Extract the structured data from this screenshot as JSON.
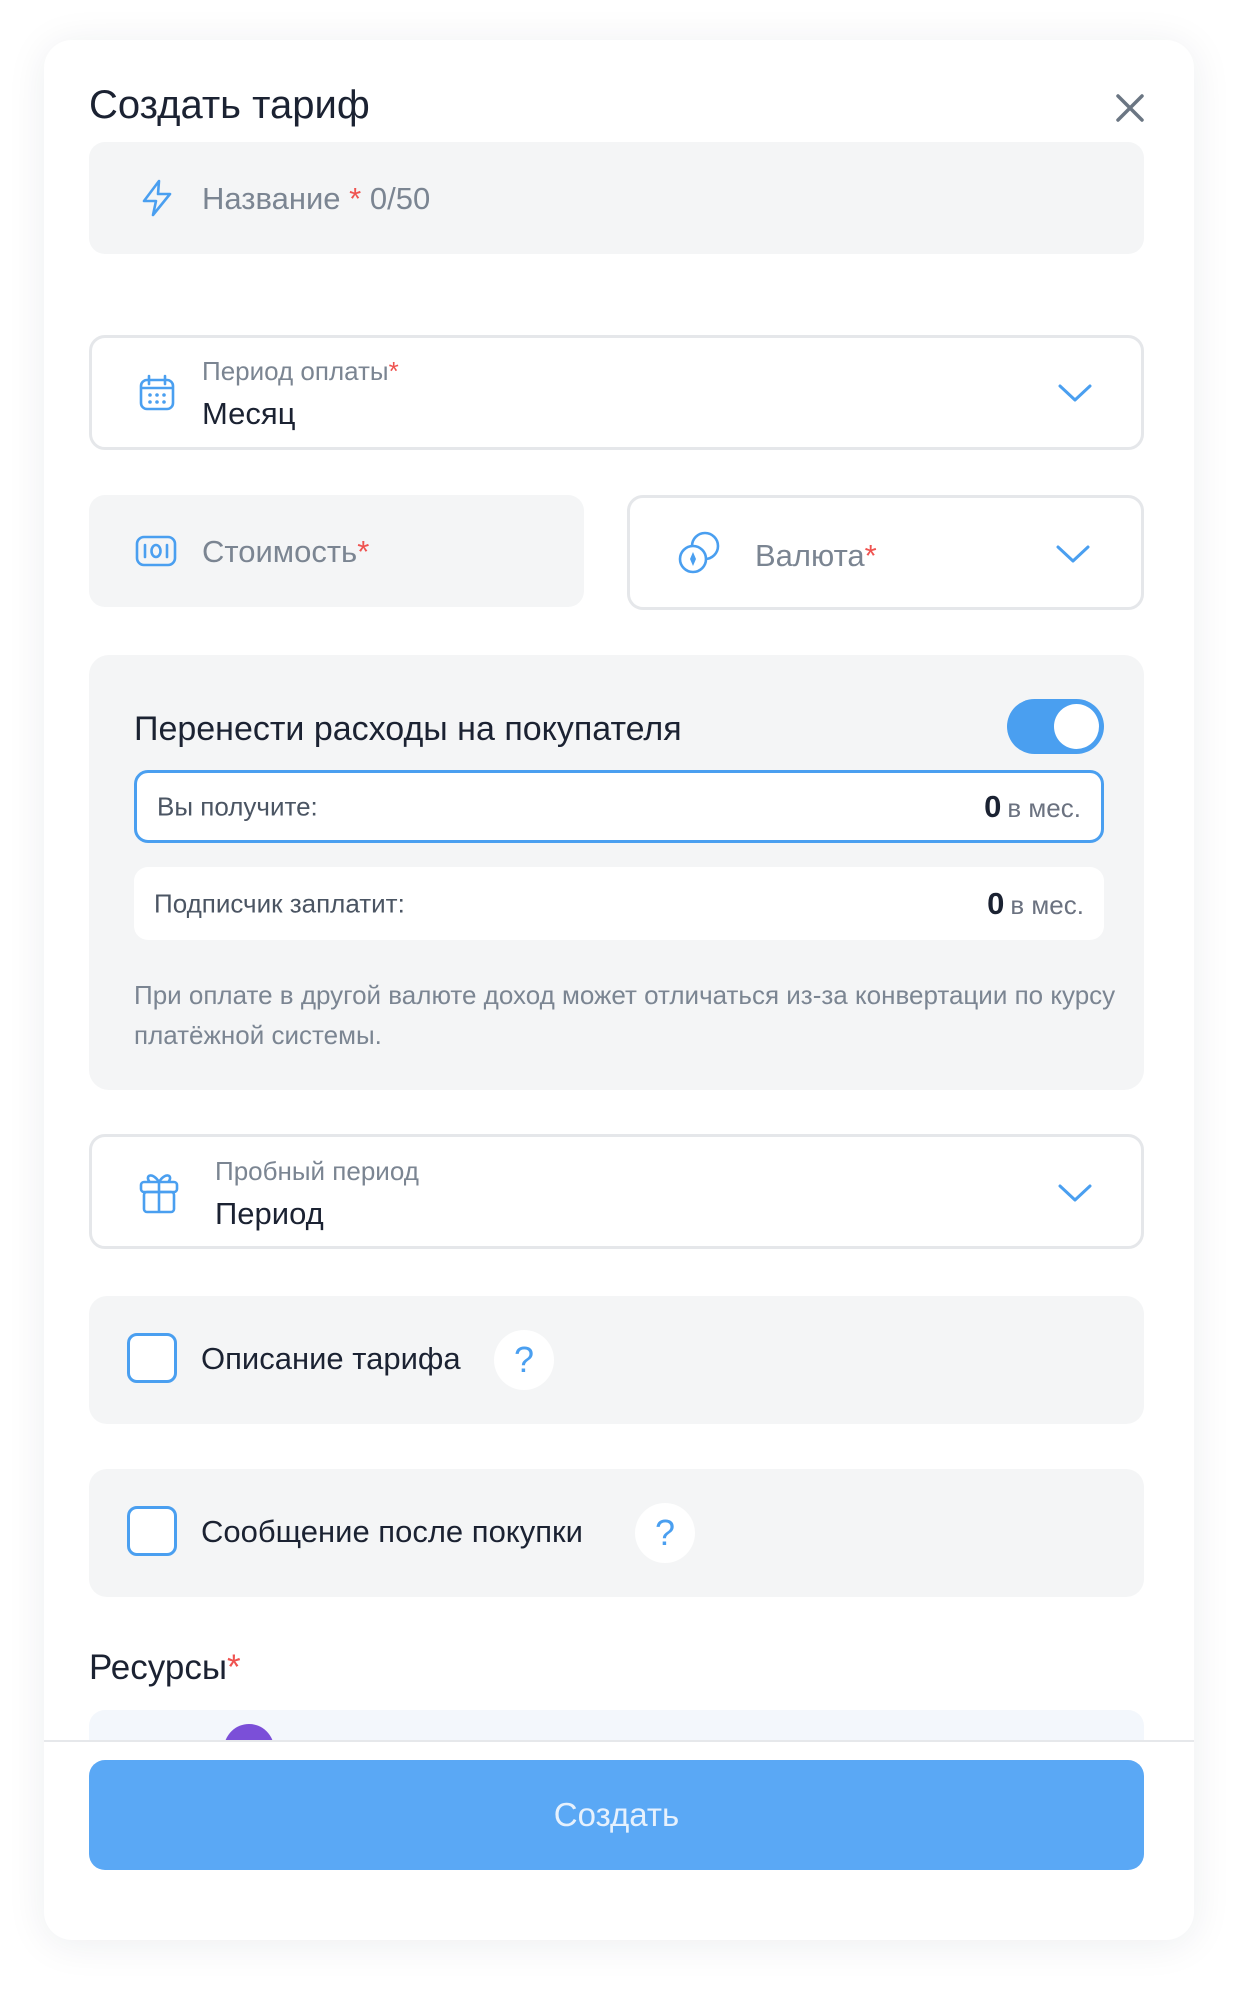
{
  "modal": {
    "title": "Создать тариф"
  },
  "name_field": {
    "placeholder": "Название",
    "required_mark": "*",
    "counter": "0/50",
    "icon": "lightning-icon"
  },
  "payment_period": {
    "label": "Период оплаты",
    "required_mark": "*",
    "value": "Месяц",
    "icon": "calendar-icon"
  },
  "price_field": {
    "placeholder": "Стоимость",
    "required_mark": "*",
    "icon": "banknote-icon"
  },
  "currency_field": {
    "placeholder": "Валюта",
    "required_mark": "*",
    "icon": "coins-icon"
  },
  "fees_panel": {
    "title": "Перенести расходы на покупателя",
    "toggle_on": true,
    "you_receive_label": "Вы получите:",
    "you_receive_amount": "0",
    "you_receive_unit": "в мес.",
    "subscriber_pays_label": "Подписчик заплатит:",
    "subscriber_pays_amount": "0",
    "subscriber_pays_unit": "в мес.",
    "note": "При оплате в другой валюте доход может отличаться из-за конвертации по курсу платёжной системы."
  },
  "trial_period": {
    "label": "Пробный период",
    "value": "Период",
    "icon": "gift-icon"
  },
  "options": [
    {
      "label": "Описание тарифа",
      "checked": false,
      "help": "?"
    },
    {
      "label": "Сообщение после покупки",
      "checked": false,
      "help": "?"
    }
  ],
  "resources": {
    "title": "Ресурсы",
    "required_mark": "*"
  },
  "footer": {
    "create_label": "Создать"
  },
  "colors": {
    "accent": "#4a9ff0",
    "button": "#5aa8f5",
    "required": "#ef5350",
    "field_bg": "#f4f5f6"
  }
}
